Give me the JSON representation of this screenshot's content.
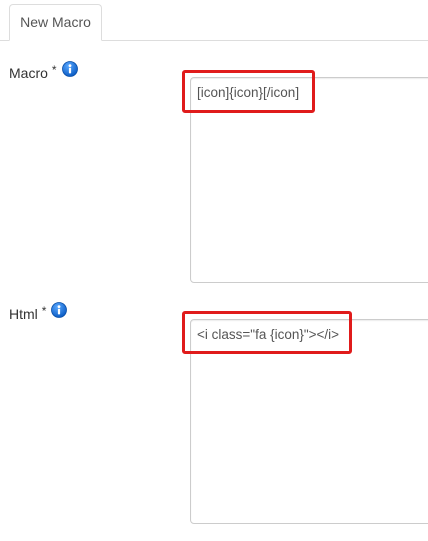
{
  "tabs": [
    {
      "label": "New Macro",
      "active": true
    }
  ],
  "form": {
    "macro": {
      "label": "Macro",
      "required_mark": "*",
      "value": "[icon]{icon}[/icon]"
    },
    "html": {
      "label": "Html",
      "required_mark": "*",
      "value": "<i class=\"fa {icon}\"></i>"
    }
  },
  "icons": {
    "info": "info-icon"
  },
  "colors": {
    "highlight": "#e01b1b",
    "info_icon": "#1a6fd1",
    "border": "#cccccc"
  }
}
